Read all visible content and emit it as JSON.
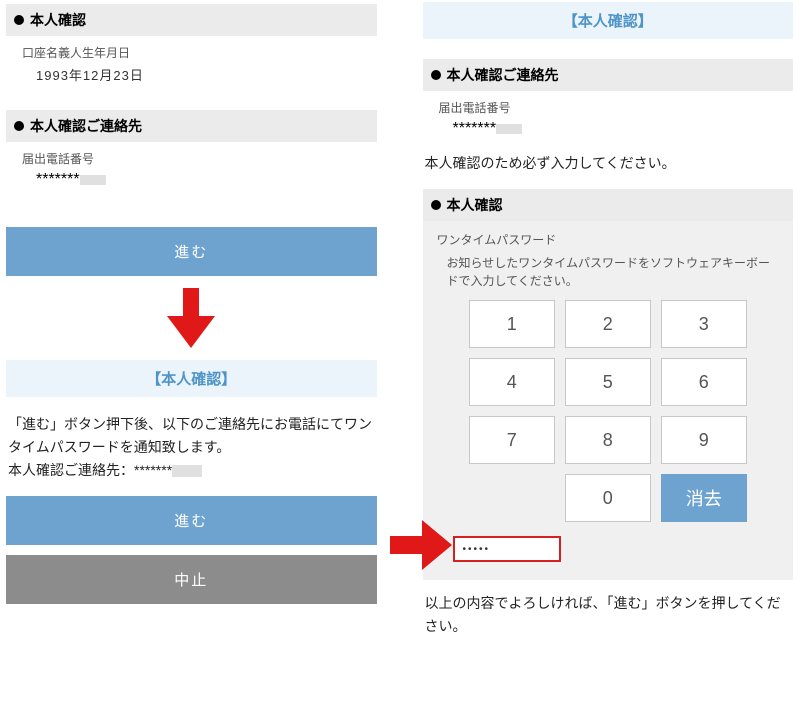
{
  "left": {
    "sec1_title": "本人確認",
    "dob_label": "口座名義人生年月日",
    "dob_value": "1993年12月23日",
    "sec2_title": "本人確認ご連絡先",
    "phone_label": "届出電話番号",
    "phone_value": "*******",
    "btn_proceed": "進む",
    "banner": "【本人確認】",
    "body1": "「進む」ボタン押下後、以下のご連絡先にお電話にてワンタイムパスワードを通知致します。",
    "body2_label": "本人確認ご連絡先：",
    "body2_value": "*******",
    "btn_proceed2": "進む",
    "btn_cancel": "中止"
  },
  "right": {
    "banner": "【本人確認】",
    "sec1_title": "本人確認ご連絡先",
    "phone_label": "届出電話番号",
    "phone_value": "*******",
    "instruction": "本人確認のため必ず入力してください。",
    "sec2_title": "本人確認",
    "otp_label": "ワンタイムパスワード",
    "otp_help": "お知らせしたワンタイムパスワードをソフトウェアキーボードで入力してください。",
    "keys": [
      "1",
      "2",
      "3",
      "4",
      "5",
      "6",
      "7",
      "8",
      "9"
    ],
    "key_zero": "0",
    "key_clear": "消去",
    "display": "•••••",
    "footer": "以上の内容でよろしければ、「進む」ボタンを押してください。"
  }
}
